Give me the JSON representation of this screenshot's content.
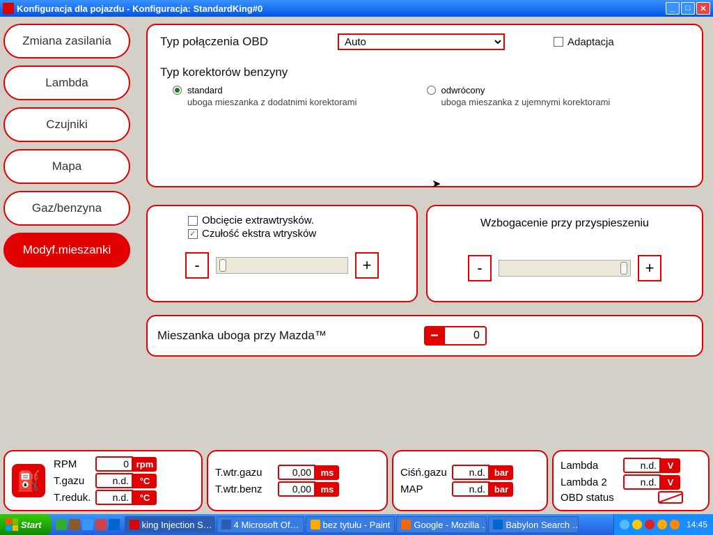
{
  "window": {
    "title": "Konfiguracja dla pojazdu - Konfiguracja: StandardKing#0"
  },
  "sidebar": {
    "items": [
      {
        "label": "Zmiana zasilania"
      },
      {
        "label": "Lambda"
      },
      {
        "label": "Czujniki"
      },
      {
        "label": "Mapa"
      },
      {
        "label": "Gaz/benzyna"
      },
      {
        "label": "Modyf.mieszanki"
      }
    ]
  },
  "obd": {
    "type_label": "Typ połączenia OBD",
    "type_value": "Auto",
    "adapt_label": "Adaptacja",
    "correctors_label": "Typ korektorów benzyny",
    "standard_label": "standard",
    "standard_desc": "uboga mieszanka z dodatnimi korektorami",
    "inverted_label": "odwrócony",
    "inverted_desc": "uboga mieszanka z ujemnymi korektorami"
  },
  "extra": {
    "cut_label": "Obcięcie extrawtrysków.",
    "sens_label": "Czułość ekstra wtrysków",
    "enrich_label": "Wzbogacenie przy przyspieszeniu",
    "minus": "-",
    "plus": "+"
  },
  "mazda": {
    "label": "Mieszanka uboga przy Mazda™",
    "minus": "−",
    "value": "0"
  },
  "status": {
    "rpm_label": "RPM",
    "rpm_val": "0",
    "rpm_unit": "rpm",
    "tgaz_label": "T.gazu",
    "tgaz_val": "n.d.",
    "tgaz_unit": "°C",
    "treduk_label": "T.reduk.",
    "treduk_val": "n.d.",
    "treduk_unit": "°C",
    "twgaz_label": "T.wtr.gazu",
    "twgaz_val": "0,00",
    "twgaz_unit": "ms",
    "twbenz_label": "T.wtr.benz",
    "twbenz_val": "0,00",
    "twbenz_unit": "ms",
    "cisn_label": "Ciśń.gazu",
    "cisn_val": "n.d.",
    "cisn_unit": "bar",
    "map_label": "MAP",
    "map_val": "n.d.",
    "map_unit": "bar",
    "lambda_label": "Lambda",
    "lambda_val": "n.d.",
    "lambda_unit": "V",
    "lambda2_label": "Lambda 2",
    "lambda2_val": "n.d.",
    "lambda2_unit": "V",
    "obdstatus_label": "OBD status"
  },
  "taskbar": {
    "start": "Start",
    "items": [
      "king Injection S…",
      "4 Microsoft Of… ",
      "bez tytułu - Paint",
      "Google - Mozilla …",
      "Babylon Search …"
    ],
    "clock": "14:45"
  }
}
